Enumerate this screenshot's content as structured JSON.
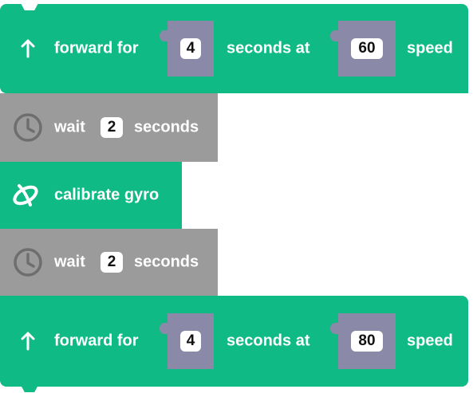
{
  "blocks": [
    {
      "kind": "forward",
      "icon": "arrow-up-icon",
      "label_forward": "forward for",
      "seconds": "4",
      "label_at": "seconds at",
      "speed": "60",
      "label_speed": "speed"
    },
    {
      "kind": "wait",
      "icon": "clock-icon",
      "label_wait": "wait",
      "seconds": "2",
      "label_seconds": "seconds"
    },
    {
      "kind": "calibrate",
      "icon": "gyro-icon",
      "label": "calibrate gyro"
    },
    {
      "kind": "wait",
      "icon": "clock-icon",
      "label_wait": "wait",
      "seconds": "2",
      "label_seconds": "seconds"
    },
    {
      "kind": "forward",
      "icon": "arrow-up-icon",
      "label_forward": "forward for",
      "seconds": "4",
      "label_at": "seconds at",
      "speed": "80",
      "label_speed": "speed"
    }
  ],
  "colors": {
    "motion_block": "#0fba84",
    "control_block": "#9b9b9b",
    "input_slot": "#8a8aa8"
  }
}
